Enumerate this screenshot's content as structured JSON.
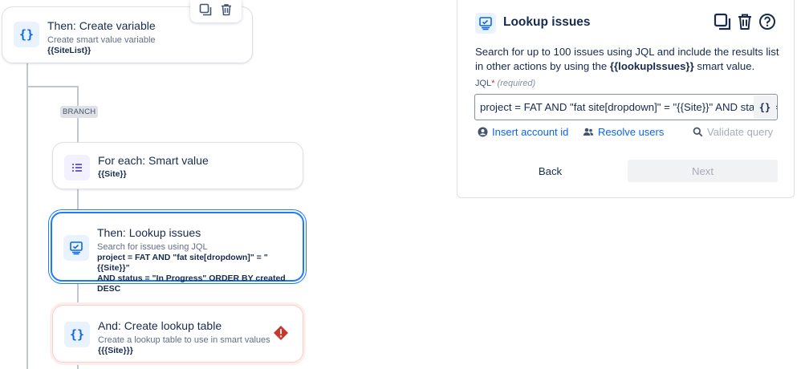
{
  "flow": {
    "branch_label": "BRANCH",
    "cards": [
      {
        "title": "Then: Create variable",
        "subtitle": "Create smart value variable",
        "detail": "{{SiteList}}",
        "icon": "curly-braces-icon"
      },
      {
        "title": "For each: Smart value",
        "detail": "{{Site}}",
        "icon": "list-icon"
      },
      {
        "title": "Then: Lookup issues",
        "subtitle": "Search for issues using JQL",
        "detail1": "project = FAT AND \"fat site[dropdown]\" = \"{{Site}}\"",
        "detail2": "AND status = \"In Progress\" ORDER BY created DESC",
        "icon": "lookup-issues-icon"
      },
      {
        "title": "And: Create lookup table",
        "subtitle": "Create a lookup table to use in smart values",
        "detail": "{{{Site}}}",
        "icon": "curly-braces-icon",
        "status": "error"
      }
    ]
  },
  "panel": {
    "title": "Lookup issues",
    "description_pre": "Search for up to 100 issues using JQL and include the results list in other actions by using the ",
    "description_bold": "{{lookupIssues}}",
    "description_post": " smart value.",
    "jql_label": "JQL",
    "jql_required": "(required)",
    "jql_value": "project = FAT AND \"fat site[dropdown]\" = \"{{Site}}\" AND status = \"In Progress\" ORDER BY created DESC",
    "smart_value_button": "{}",
    "links": {
      "insert_account": "Insert account id",
      "resolve_users": "Resolve users",
      "validate_query": "Validate query"
    },
    "back_label": "Back",
    "next_label": "Next"
  },
  "colors": {
    "accent": "#0c66e4",
    "selected_border": "#1d7afc",
    "error": "#c9372c",
    "connector": "#c1c7d0"
  }
}
